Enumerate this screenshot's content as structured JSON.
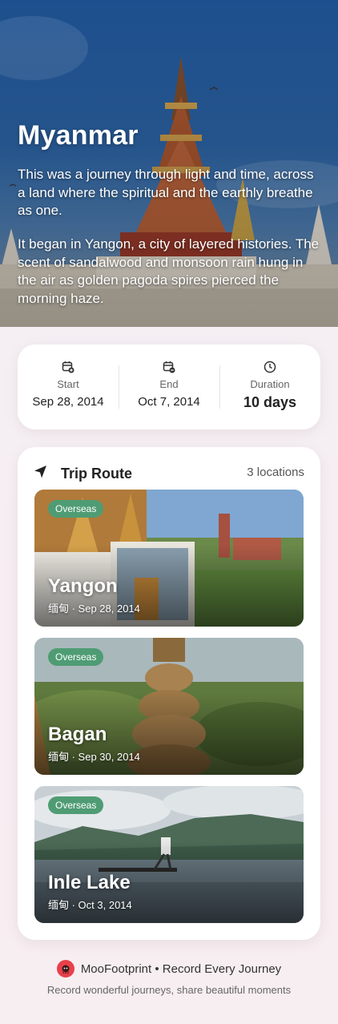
{
  "hero": {
    "title": "Myanmar",
    "paragraph_1": "This was a journey through light and time, across a land where the spiritual and the earthly breathe as one.",
    "paragraph_2": "It began in Yangon, a city of layered histories. The scent of sandalwood and monsoon rain hung in the air as golden pagoda spires pierced the morning haze."
  },
  "dates": {
    "start_label": "Start",
    "start_value": "Sep 28, 2014",
    "end_label": "End",
    "end_value": "Oct 7, 2014",
    "duration_label": "Duration",
    "duration_value": "10 days",
    "icons": [
      "calendar-plus-icon",
      "calendar-minus-icon",
      "clock-icon"
    ]
  },
  "route": {
    "title": "Trip Route",
    "count": "3 locations",
    "icon": "navigation-arrow-icon",
    "locations": [
      {
        "tag": "Overseas",
        "name": "Yangon",
        "meta": "缅甸 · Sep 28, 2014"
      },
      {
        "tag": "Overseas",
        "name": "Bagan",
        "meta": "缅甸 · Sep 30, 2014"
      },
      {
        "tag": "Overseas",
        "name": "Inle Lake",
        "meta": "缅甸 · Oct 3, 2014"
      }
    ]
  },
  "footer": {
    "brand": "MooFootprint • Record Every Journey",
    "tagline": "Record wonderful journeys, share beautiful moments"
  },
  "colors": {
    "tag_green": "#4f9c74",
    "logo_red": "#e8404a"
  }
}
